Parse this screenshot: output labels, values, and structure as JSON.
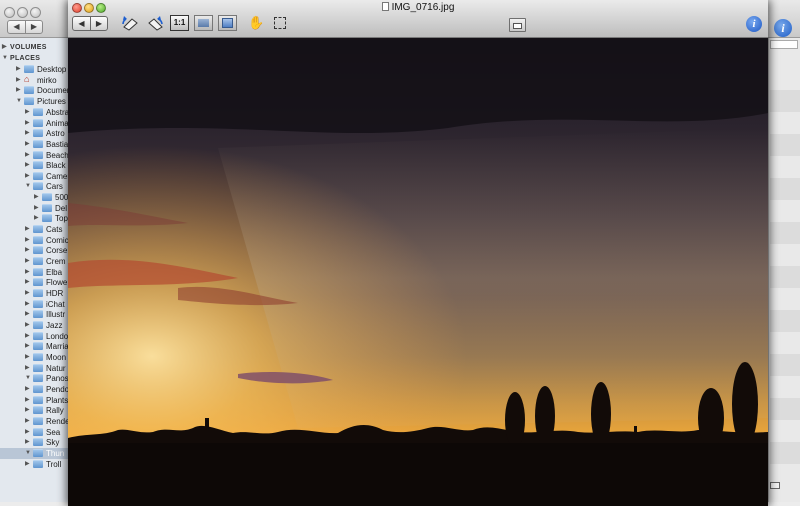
{
  "finder": {
    "nav_back": "◀",
    "nav_forward": "▶",
    "info": "i",
    "sidebar": {
      "sections": [
        {
          "label": "VOLUMES"
        },
        {
          "label": "PLACES"
        }
      ],
      "items": [
        {
          "label": "Desktop"
        },
        {
          "label": "mirko"
        },
        {
          "label": "Documen"
        },
        {
          "label": "Pictures"
        },
        {
          "label": "Abstra"
        },
        {
          "label": "Anima"
        },
        {
          "label": "Astro"
        },
        {
          "label": "Bastia"
        },
        {
          "label": "Beach"
        },
        {
          "label": "Black"
        },
        {
          "label": "Camer"
        },
        {
          "label": "Cars"
        },
        {
          "label": "500"
        },
        {
          "label": "Del"
        },
        {
          "label": "Top"
        },
        {
          "label": "Cats"
        },
        {
          "label": "Comic"
        },
        {
          "label": "Corse"
        },
        {
          "label": "Crem"
        },
        {
          "label": "Elba"
        },
        {
          "label": "Flowe"
        },
        {
          "label": "HDR"
        },
        {
          "label": "iChat"
        },
        {
          "label": "Illustr"
        },
        {
          "label": "Jazz"
        },
        {
          "label": "Londo"
        },
        {
          "label": "Marria"
        },
        {
          "label": "Moon"
        },
        {
          "label": "Natur"
        },
        {
          "label": "Panos"
        },
        {
          "label": "Pendo"
        },
        {
          "label": "Plants"
        },
        {
          "label": "Rally"
        },
        {
          "label": "Rende"
        },
        {
          "label": "Sea"
        },
        {
          "label": "Sky"
        },
        {
          "label": "Thun"
        },
        {
          "label": "Troll"
        }
      ]
    }
  },
  "preview": {
    "title": "IMG_0716.jpg",
    "nav_back": "◀",
    "nav_forward": "▶",
    "actual_size_label": "1:1",
    "hand": "✋",
    "info": "i"
  }
}
